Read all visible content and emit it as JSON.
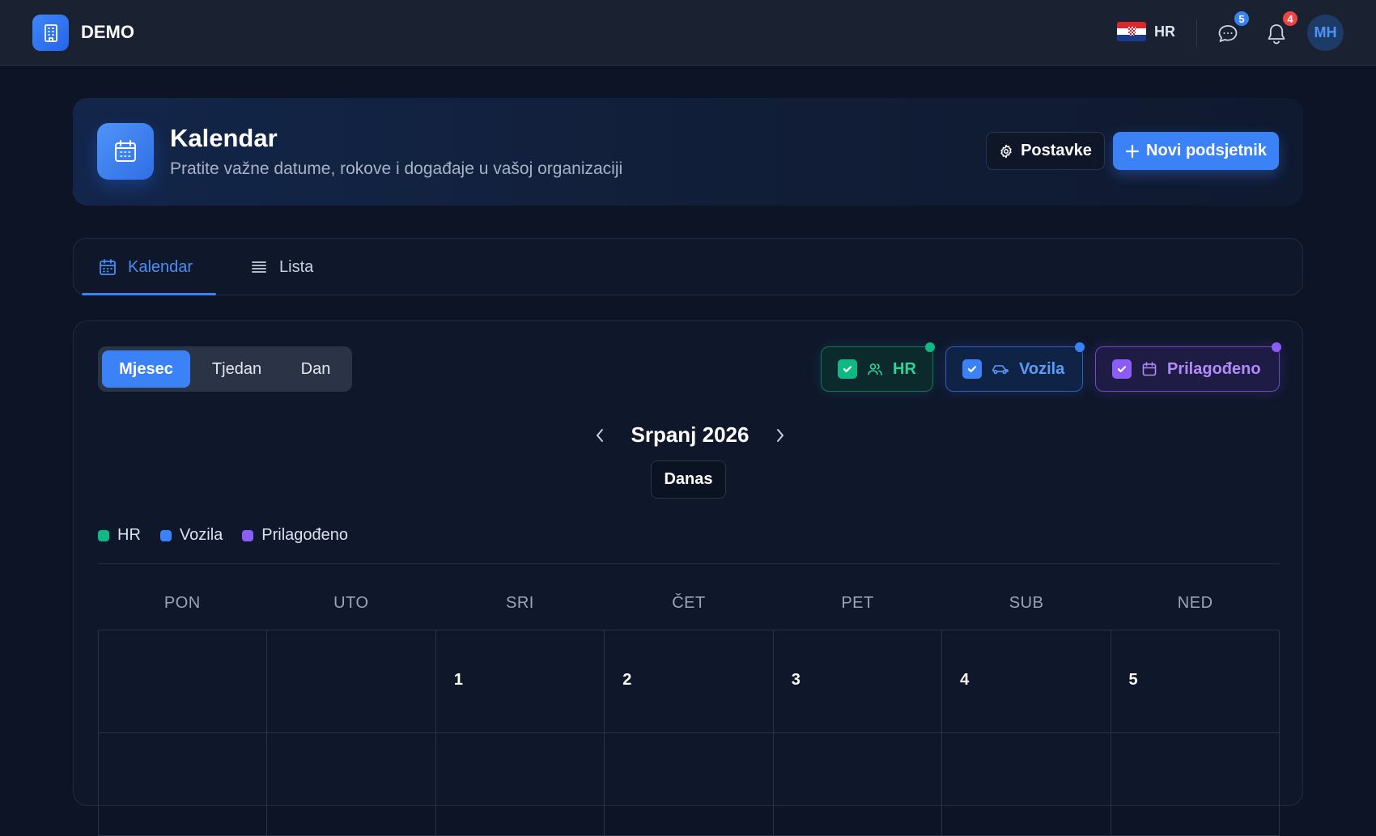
{
  "app": {
    "brand": "DEMO"
  },
  "header": {
    "language": "HR",
    "messages_count": "5",
    "notifications_count": "4",
    "user_initials": "MH"
  },
  "page": {
    "title": "Kalendar",
    "subtitle": "Pratite važne datume, rokove i događaje u vašoj organizaciji",
    "settings_label": "Postavke",
    "new_reminder_label": "Novi podsjetnik"
  },
  "tabs": [
    {
      "label": "Kalendar",
      "active": true
    },
    {
      "label": "Lista",
      "active": false
    }
  ],
  "view_modes": [
    {
      "label": "Mjesec",
      "active": true
    },
    {
      "label": "Tjedan",
      "active": false
    },
    {
      "label": "Dan",
      "active": false
    }
  ],
  "filters": [
    {
      "label": "HR",
      "checked": true,
      "color": "#10b981",
      "icon": "users-icon"
    },
    {
      "label": "Vozila",
      "checked": true,
      "color": "#3b82f6",
      "icon": "car-icon"
    },
    {
      "label": "Prilagođeno",
      "checked": true,
      "color": "#8b5cf6",
      "icon": "calendar-icon"
    }
  ],
  "calendar": {
    "month_label": "Srpanj 2026",
    "today_label": "Danas",
    "weekdays": [
      "PON",
      "UTO",
      "SRI",
      "ČET",
      "PET",
      "SUB",
      "NED"
    ],
    "weeks": [
      [
        "",
        "",
        "1",
        "2",
        "3",
        "4",
        "5"
      ],
      [
        "",
        "",
        "",
        "",
        "",
        "",
        ""
      ]
    ]
  },
  "legend": [
    {
      "label": "HR",
      "color": "#10b981"
    },
    {
      "label": "Vozila",
      "color": "#3b82f6"
    },
    {
      "label": "Prilagođeno",
      "color": "#8b5cf6"
    }
  ],
  "colors": {
    "accent": "#3b82f6",
    "hr": "#10b981",
    "vehicles": "#3b82f6",
    "custom": "#8b5cf6",
    "badge_messages": "#3b82f6",
    "badge_notifications": "#ef4444"
  }
}
